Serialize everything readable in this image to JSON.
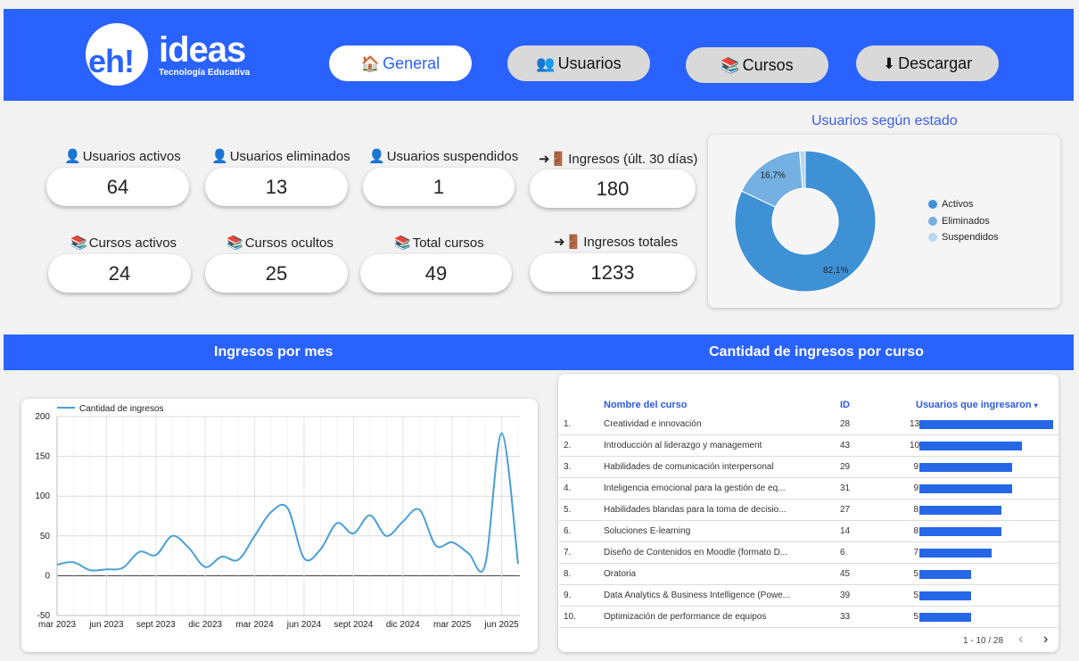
{
  "header": {
    "logo_main": "eh!",
    "logo_word": "ideas",
    "logo_tagline": "Tecnología Educativa",
    "nav": [
      {
        "label": "General",
        "icon": "house-icon",
        "active": true
      },
      {
        "label": "Usuarios",
        "icon": "users-icon",
        "active": false
      },
      {
        "label": "Cursos",
        "icon": "books-icon",
        "active": false
      },
      {
        "label": "Descargar",
        "icon": "download-icon",
        "active": false
      }
    ]
  },
  "kpis": [
    {
      "label": "Usuarios activos",
      "value": "64",
      "icon": "user-icon"
    },
    {
      "label": "Usuarios eliminados",
      "value": "13",
      "icon": "user-icon"
    },
    {
      "label": "Usuarios suspendidos",
      "value": "1",
      "icon": "user-icon"
    },
    {
      "label": "Ingresos (últ. 30 días)",
      "value": "180",
      "icon": "door-arrow-icon"
    },
    {
      "label": "Cursos activos",
      "value": "24",
      "icon": "books-icon"
    },
    {
      "label": "Cursos ocultos",
      "value": "25",
      "icon": "books-icon"
    },
    {
      "label": "Total cursos",
      "value": "49",
      "icon": "books-icon"
    },
    {
      "label": "Ingresos totales",
      "value": "1233",
      "icon": "door-arrow-icon"
    }
  ],
  "sections": {
    "pie_title": "Usuarios según estado",
    "line_title": "Ingresos por mes",
    "table_title": "Cantidad de ingresos por curso"
  },
  "colors": {
    "brand": "#2962ff",
    "activos": "#3f91d6",
    "eliminados": "#74b0e2",
    "suspendidos": "#b6d6f1",
    "line": "#4a9fd8",
    "bar": "#2667e8"
  },
  "chart_data": [
    {
      "type": "pie",
      "title": "Usuarios según estado",
      "categories": [
        "Activos",
        "Eliminados",
        "Suspendidos"
      ],
      "values": [
        64,
        13,
        1
      ],
      "data_labels": [
        "82,1%",
        "16,7%",
        ""
      ],
      "legend": "right",
      "donut": true
    },
    {
      "type": "line",
      "title": "",
      "series": [
        {
          "name": "Cantidad de ingresos",
          "x": [
            "2023-03",
            "2023-04",
            "2023-05",
            "2023-06",
            "2023-07",
            "2023-08",
            "2023-09",
            "2023-10",
            "2023-11",
            "2023-12",
            "2024-01",
            "2024-02",
            "2024-03",
            "2024-04",
            "2024-05",
            "2024-06",
            "2024-07",
            "2024-08",
            "2024-09",
            "2024-10",
            "2024-11",
            "2024-12",
            "2025-01",
            "2025-02",
            "2025-03",
            "2025-04",
            "2025-05",
            "2025-06",
            "2025-07"
          ],
          "y": [
            14,
            17,
            7,
            8,
            10,
            30,
            26,
            50,
            35,
            11,
            24,
            20,
            50,
            80,
            85,
            22,
            33,
            66,
            53,
            76,
            50,
            68,
            83,
            38,
            42,
            28,
            14,
            179,
            15
          ]
        }
      ],
      "x_ticks": [
        "mar 2023",
        "jun 2023",
        "sept 2023",
        "dic 2023",
        "mar 2024",
        "jun 2024",
        "sept 2024",
        "dic 2024",
        "mar 2025",
        "jun 2025"
      ],
      "y_ticks": [
        "200",
        "150",
        "100",
        "50",
        "0",
        "-50"
      ],
      "ylim": [
        -50,
        200
      ],
      "grid": true,
      "legend": "top-left"
    },
    {
      "type": "table",
      "columns": [
        "Nombre del curso",
        "ID",
        "Usuarios que ingresaron"
      ],
      "rows": [
        {
          "rank": "1.",
          "name": "Creatividad e innovación",
          "id": "28",
          "value": 13
        },
        {
          "rank": "2.",
          "name": "Introducción al liderazgo y management",
          "id": "43",
          "value": 10
        },
        {
          "rank": "3.",
          "name": "Habilidades de comunicación interpersonal",
          "id": "29",
          "value": 9
        },
        {
          "rank": "4.",
          "name": "Inteligencia emocional para la gestión de eq...",
          "id": "31",
          "value": 9
        },
        {
          "rank": "5.",
          "name": "Habilidades blandas para la toma de decisio...",
          "id": "27",
          "value": 8
        },
        {
          "rank": "6.",
          "name": "Soluciones E-learning",
          "id": "14",
          "value": 8
        },
        {
          "rank": "7.",
          "name": "Diseño de Contenidos en Moodle (formato D...",
          "id": "6",
          "value": 7
        },
        {
          "rank": "8.",
          "name": "Oratoria",
          "id": "45",
          "value": 5
        },
        {
          "rank": "9.",
          "name": "Data Analytics & Business Intelligence (Powe...",
          "id": "39",
          "value": 5
        },
        {
          "rank": "10.",
          "name": "Optimización de performance de equipos",
          "id": "33",
          "value": 5
        }
      ],
      "sort": "descending",
      "value_max": 13
    }
  ],
  "pager": {
    "text": "1 - 10 / 28",
    "prev": "‹",
    "next": "›"
  }
}
